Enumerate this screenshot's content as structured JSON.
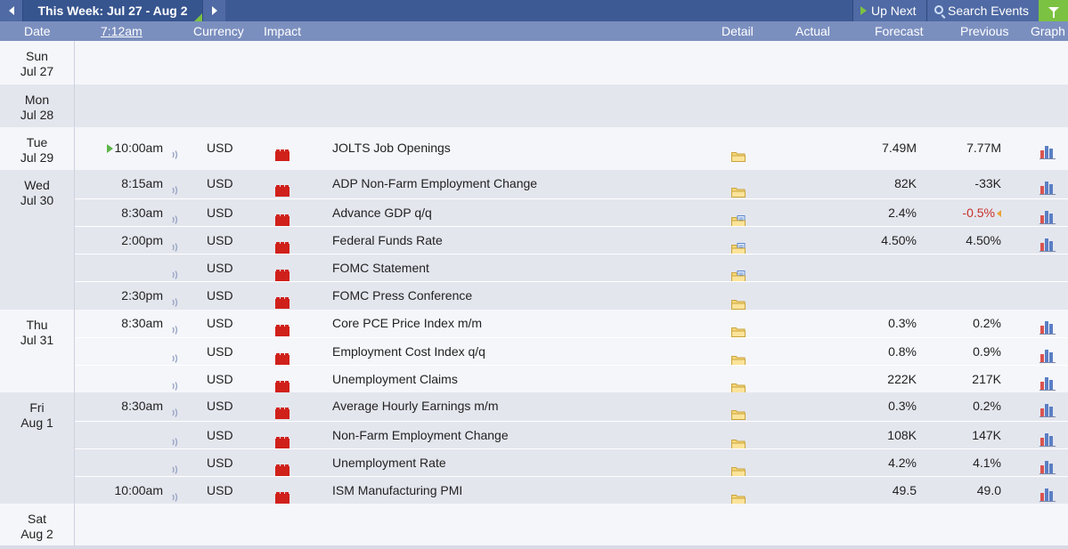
{
  "toolbar": {
    "week_title": "This Week: Jul 27 - Aug 2",
    "up_next_label": "Up Next",
    "search_label": "Search Events"
  },
  "columns": {
    "date": "Date",
    "time": "7:12am",
    "currency": "Currency",
    "impact": "Impact",
    "detail": "Detail",
    "actual": "Actual",
    "forecast": "Forecast",
    "previous": "Previous",
    "graph": "Graph"
  },
  "colors": {
    "toolbar_bg": "#3e5a95",
    "header_bg": "#7b8fbf",
    "accent_green": "#7cc242",
    "high_impact_red": "#d0201a",
    "negative_red": "#c8312a"
  },
  "days": [
    {
      "weekday": "Sun",
      "date": "Jul 27",
      "events": []
    },
    {
      "weekday": "Mon",
      "date": "Jul 28",
      "events": []
    },
    {
      "weekday": "Tue",
      "date": "Jul 29",
      "events": [
        {
          "time": "10:00am",
          "currency": "USD",
          "impact": "high",
          "title": "JOLTS Job Openings",
          "actual": "",
          "forecast": "7.49M",
          "previous": "7.77M",
          "up_next": true,
          "detail_icon": "folder-icon",
          "graph": true
        }
      ]
    },
    {
      "weekday": "Wed",
      "date": "Jul 30",
      "events": [
        {
          "time": "8:15am",
          "currency": "USD",
          "impact": "high",
          "title": "ADP Non-Farm Employment Change",
          "actual": "",
          "forecast": "82K",
          "previous": "-33K",
          "detail_icon": "folder-icon",
          "graph": true
        },
        {
          "time": "8:30am",
          "currency": "USD",
          "impact": "high",
          "title": "Advance GDP q/q",
          "actual": "",
          "forecast": "2.4%",
          "previous": "-0.5%",
          "previous_revised": true,
          "detail_icon": "folder-doc-icon",
          "graph": true
        },
        {
          "time": "2:00pm",
          "currency": "USD",
          "impact": "high",
          "title": "Federal Funds Rate",
          "actual": "",
          "forecast": "4.50%",
          "previous": "4.50%",
          "detail_icon": "folder-doc-icon",
          "graph": true
        },
        {
          "time": "",
          "currency": "USD",
          "impact": "high",
          "title": "FOMC Statement",
          "actual": "",
          "forecast": "",
          "previous": "",
          "detail_icon": "folder-doc-icon",
          "graph": false
        },
        {
          "time": "2:30pm",
          "currency": "USD",
          "impact": "high",
          "title": "FOMC Press Conference",
          "actual": "",
          "forecast": "",
          "previous": "",
          "detail_icon": "folder-icon",
          "graph": false
        }
      ]
    },
    {
      "weekday": "Thu",
      "date": "Jul 31",
      "events": [
        {
          "time": "8:30am",
          "currency": "USD",
          "impact": "high",
          "title": "Core PCE Price Index m/m",
          "actual": "",
          "forecast": "0.3%",
          "previous": "0.2%",
          "detail_icon": "folder-icon",
          "graph": true
        },
        {
          "time": "",
          "currency": "USD",
          "impact": "high",
          "title": "Employment Cost Index q/q",
          "actual": "",
          "forecast": "0.8%",
          "previous": "0.9%",
          "detail_icon": "folder-icon",
          "graph": true
        },
        {
          "time": "",
          "currency": "USD",
          "impact": "high",
          "title": "Unemployment Claims",
          "actual": "",
          "forecast": "222K",
          "previous": "217K",
          "detail_icon": "folder-icon",
          "graph": true
        }
      ]
    },
    {
      "weekday": "Fri",
      "date": "Aug 1",
      "events": [
        {
          "time": "8:30am",
          "currency": "USD",
          "impact": "high",
          "title": "Average Hourly Earnings m/m",
          "actual": "",
          "forecast": "0.3%",
          "previous": "0.2%",
          "detail_icon": "folder-icon",
          "graph": true
        },
        {
          "time": "",
          "currency": "USD",
          "impact": "high",
          "title": "Non-Farm Employment Change",
          "actual": "",
          "forecast": "108K",
          "previous": "147K",
          "detail_icon": "folder-icon",
          "graph": true
        },
        {
          "time": "",
          "currency": "USD",
          "impact": "high",
          "title": "Unemployment Rate",
          "actual": "",
          "forecast": "4.2%",
          "previous": "4.1%",
          "detail_icon": "folder-icon",
          "graph": true
        },
        {
          "time": "10:00am",
          "currency": "USD",
          "impact": "high",
          "title": "ISM Manufacturing PMI",
          "actual": "",
          "forecast": "49.5",
          "previous": "49.0",
          "detail_icon": "folder-icon",
          "graph": true
        }
      ]
    },
    {
      "weekday": "Sat",
      "date": "Aug 2",
      "events": []
    }
  ]
}
